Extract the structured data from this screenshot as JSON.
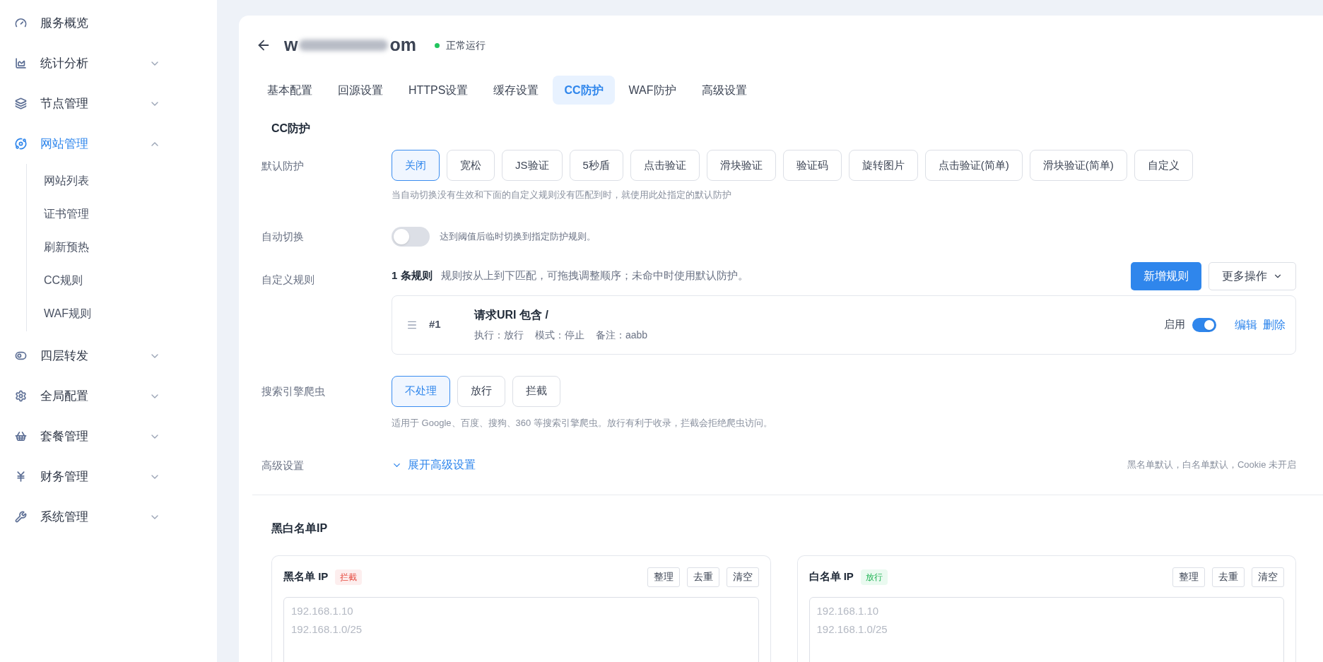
{
  "sidebar": {
    "items": [
      {
        "label": "服务概览",
        "selected": false
      },
      {
        "label": "统计分析",
        "selected": false,
        "expanded": false
      },
      {
        "label": "节点管理",
        "selected": false,
        "expanded": false
      },
      {
        "label": "网站管理",
        "selected": true,
        "expanded": true,
        "children": [
          {
            "label": "网站列表",
            "selected": false
          },
          {
            "label": "证书管理",
            "selected": false
          },
          {
            "label": "刷新预热",
            "selected": false
          },
          {
            "label": "CC规则",
            "selected": false
          },
          {
            "label": "WAF规则",
            "selected": false
          }
        ]
      },
      {
        "label": "四层转发",
        "selected": false,
        "expanded": false
      },
      {
        "label": "全局配置",
        "selected": false,
        "expanded": false
      },
      {
        "label": "套餐管理",
        "selected": false,
        "expanded": false
      },
      {
        "label": "财务管理",
        "selected": false,
        "expanded": false
      },
      {
        "label": "系统管理",
        "selected": false,
        "expanded": false
      }
    ]
  },
  "header": {
    "title_start": "w",
    "title_end": "om",
    "status": {
      "label": "正常运行",
      "ok": true
    }
  },
  "tabs": [
    {
      "label": "基本配置",
      "selected": false
    },
    {
      "label": "回源设置",
      "selected": false
    },
    {
      "label": "HTTPS设置",
      "selected": false
    },
    {
      "label": "缓存设置",
      "selected": false
    },
    {
      "label": "CC防护",
      "selected": true
    },
    {
      "label": "WAF防护",
      "selected": false
    },
    {
      "label": "高级设置",
      "selected": false
    }
  ],
  "cc": {
    "title": "CC防护",
    "default_protection": {
      "label": "默认防护",
      "hint": "当自动切换没有生效和下面的自定义规则没有匹配到时，就使用此处指定的默认防护",
      "options": [
        {
          "label": "关闭",
          "selected": true
        },
        {
          "label": "宽松",
          "selected": false
        },
        {
          "label": "JS验证",
          "selected": false
        },
        {
          "label": "5秒盾",
          "selected": false
        },
        {
          "label": "点击验证",
          "selected": false
        },
        {
          "label": "滑块验证",
          "selected": false
        },
        {
          "label": "验证码",
          "selected": false
        },
        {
          "label": "旋转图片",
          "selected": false
        },
        {
          "label": "点击验证(简单)",
          "selected": false
        },
        {
          "label": "滑块验证(简单)",
          "selected": false
        },
        {
          "label": "自定义",
          "selected": false
        }
      ]
    },
    "auto_switch": {
      "label": "自动切换",
      "on": false,
      "hint": "达到阈值后临时切换到指定防护规则。"
    },
    "custom_rules": {
      "label": "自定义规则",
      "count": "1 条规则",
      "description": "规则按从上到下匹配，可拖拽调整顺序；未命中时使用默认防护。",
      "add_button": "新增规则",
      "more_button": "更多操作",
      "rules": [
        {
          "number": "#1",
          "title": "请求URI 包含 /",
          "details": [
            "执行：放行",
            "模式：停止",
            "备注：aabb"
          ],
          "enabled_label": "启用",
          "enabled": true,
          "actions": [
            "编辑",
            "删除"
          ]
        }
      ]
    },
    "crawler": {
      "label": "搜索引擎爬虫",
      "hint": "适用于 Google、百度、搜狗、360 等搜索引擎爬虫。放行有利于收录，拦截会拒绝爬虫访问。",
      "options": [
        {
          "label": "不处理",
          "selected": true
        },
        {
          "label": "放行",
          "selected": false
        },
        {
          "label": "拦截",
          "selected": false
        }
      ]
    },
    "advanced": {
      "label": "高级设置",
      "toggle": "展开高级设置",
      "expanded": false,
      "summary": "黑名单默认，白名单默认，Cookie 未开启"
    }
  },
  "ip_lists": {
    "title": "黑白名单IP",
    "panels": [
      {
        "kind": "block",
        "title": "黑名单 IP",
        "tag": "拦截",
        "buttons": [
          "整理",
          "去重",
          "清空"
        ],
        "placeholder": "192.168.1.10\n192.168.1.0/25"
      },
      {
        "kind": "allow",
        "title": "白名单 IP",
        "tag": "放行",
        "buttons": [
          "整理",
          "去重",
          "清空"
        ],
        "placeholder": "192.168.1.10\n192.168.1.0/25"
      }
    ]
  }
}
